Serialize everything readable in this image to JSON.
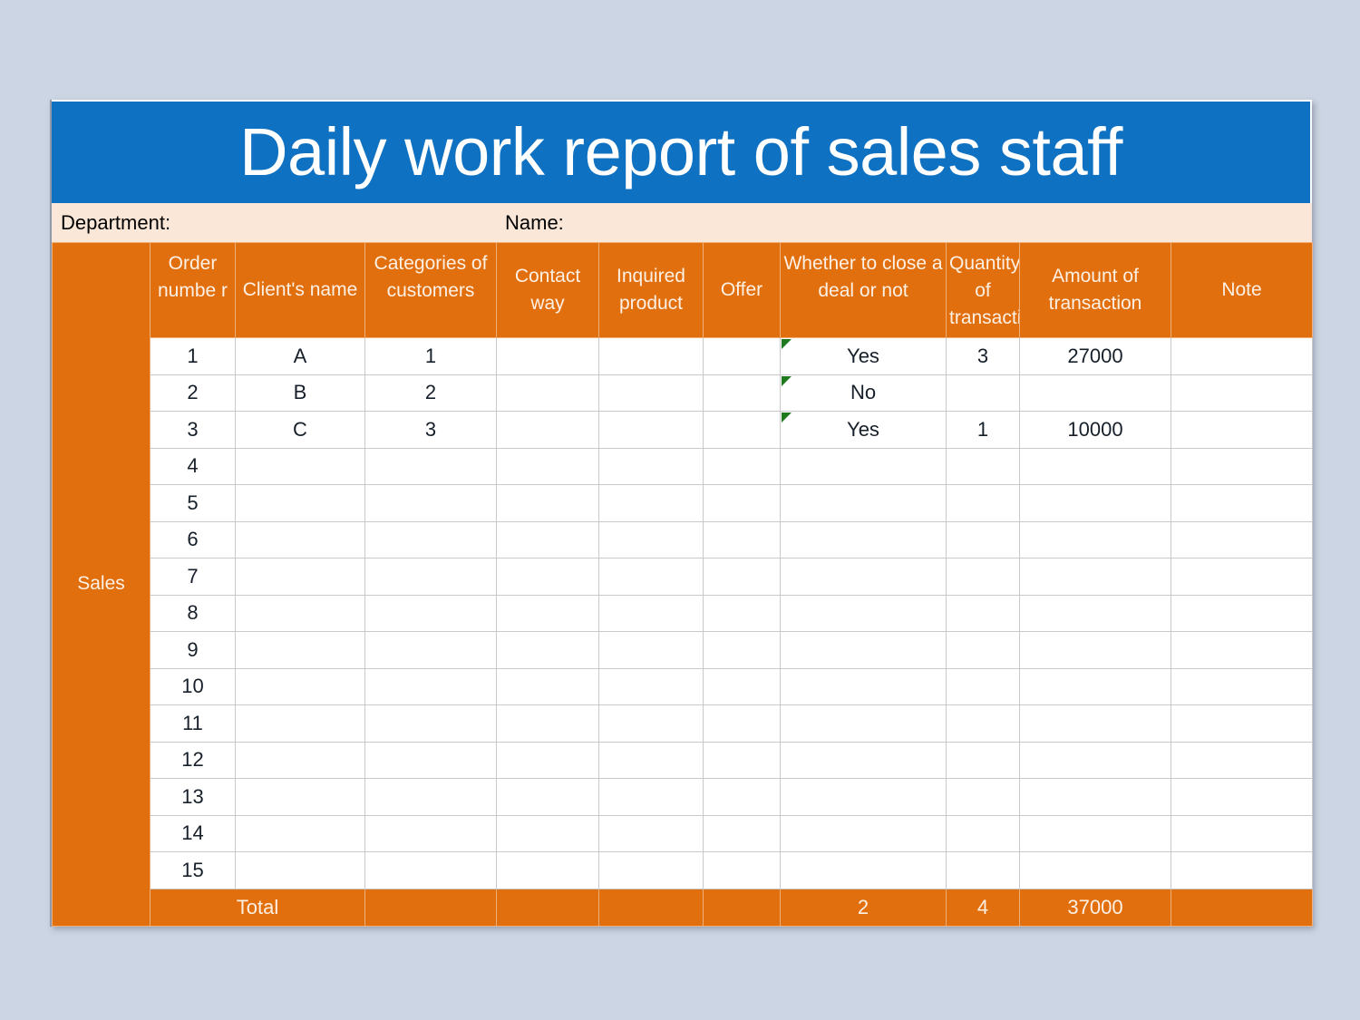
{
  "document": {
    "title": "Daily work report of sales staff"
  },
  "info_band": {
    "department_label": "Department:",
    "name_label": "Name:"
  },
  "table": {
    "group_label": "Sales",
    "headers": [
      "Order numbe r",
      "Client's name",
      "Categories of customers",
      "Contact way",
      "Inquired product",
      "Offer",
      "Whether to close a deal or not",
      "Quantity of transactio",
      "Amount of transaction",
      "Note"
    ],
    "rows": [
      {
        "order": "1",
        "client": "A",
        "category": "1",
        "contact": "",
        "product": "",
        "offer": "",
        "deal": "Yes",
        "quantity": "3",
        "amount": "27000",
        "note": "",
        "flag": true
      },
      {
        "order": "2",
        "client": "B",
        "category": "2",
        "contact": "",
        "product": "",
        "offer": "",
        "deal": "No",
        "quantity": "",
        "amount": "",
        "note": "",
        "flag": true
      },
      {
        "order": "3",
        "client": "C",
        "category": "3",
        "contact": "",
        "product": "",
        "offer": "",
        "deal": "Yes",
        "quantity": "1",
        "amount": "10000",
        "note": "",
        "flag": true
      },
      {
        "order": "4",
        "client": "",
        "category": "",
        "contact": "",
        "product": "",
        "offer": "",
        "deal": "",
        "quantity": "",
        "amount": "",
        "note": "",
        "flag": false
      },
      {
        "order": "5",
        "client": "",
        "category": "",
        "contact": "",
        "product": "",
        "offer": "",
        "deal": "",
        "quantity": "",
        "amount": "",
        "note": "",
        "flag": false
      },
      {
        "order": "6",
        "client": "",
        "category": "",
        "contact": "",
        "product": "",
        "offer": "",
        "deal": "",
        "quantity": "",
        "amount": "",
        "note": "",
        "flag": false
      },
      {
        "order": "7",
        "client": "",
        "category": "",
        "contact": "",
        "product": "",
        "offer": "",
        "deal": "",
        "quantity": "",
        "amount": "",
        "note": "",
        "flag": false
      },
      {
        "order": "8",
        "client": "",
        "category": "",
        "contact": "",
        "product": "",
        "offer": "",
        "deal": "",
        "quantity": "",
        "amount": "",
        "note": "",
        "flag": false
      },
      {
        "order": "9",
        "client": "",
        "category": "",
        "contact": "",
        "product": "",
        "offer": "",
        "deal": "",
        "quantity": "",
        "amount": "",
        "note": "",
        "flag": false
      },
      {
        "order": "10",
        "client": "",
        "category": "",
        "contact": "",
        "product": "",
        "offer": "",
        "deal": "",
        "quantity": "",
        "amount": "",
        "note": "",
        "flag": false
      },
      {
        "order": "11",
        "client": "",
        "category": "",
        "contact": "",
        "product": "",
        "offer": "",
        "deal": "",
        "quantity": "",
        "amount": "",
        "note": "",
        "flag": false
      },
      {
        "order": "12",
        "client": "",
        "category": "",
        "contact": "",
        "product": "",
        "offer": "",
        "deal": "",
        "quantity": "",
        "amount": "",
        "note": "",
        "flag": false
      },
      {
        "order": "13",
        "client": "",
        "category": "",
        "contact": "",
        "product": "",
        "offer": "",
        "deal": "",
        "quantity": "",
        "amount": "",
        "note": "",
        "flag": false
      },
      {
        "order": "14",
        "client": "",
        "category": "",
        "contact": "",
        "product": "",
        "offer": "",
        "deal": "",
        "quantity": "",
        "amount": "",
        "note": "",
        "flag": false
      },
      {
        "order": "15",
        "client": "",
        "category": "",
        "contact": "",
        "product": "",
        "offer": "",
        "deal": "",
        "quantity": "",
        "amount": "",
        "note": "",
        "flag": false
      }
    ],
    "total": {
      "label": "Total",
      "contact": "",
      "product": "",
      "offer": "",
      "deal": "2",
      "quantity": "4",
      "amount": "37000",
      "note": ""
    }
  },
  "colors": {
    "title_blue": "#0f71c1",
    "header_orange": "#e26f0d",
    "info_peach": "#fbe7d7",
    "page_background": "#ccd5e3",
    "flag_green": "#1f7a1f"
  }
}
